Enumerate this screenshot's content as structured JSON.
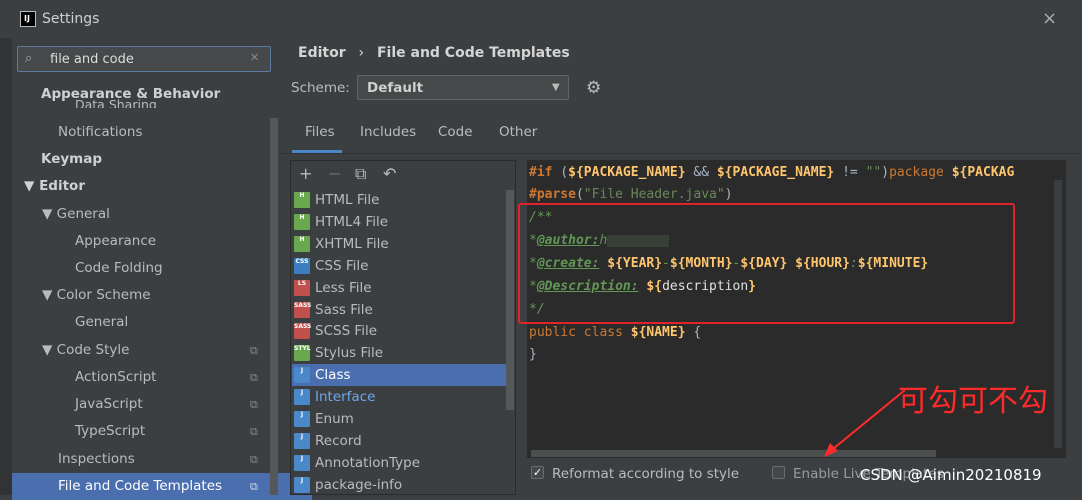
{
  "window": {
    "title": "Settings",
    "close_icon": "×"
  },
  "search": {
    "value": "file and code"
  },
  "sidebar": {
    "items": [
      {
        "label": "Appearance & Behavior",
        "sub": "Data Sharing"
      },
      {
        "label": "Notifications"
      },
      {
        "label": "Keymap"
      },
      {
        "label": "▼ Editor"
      },
      {
        "label": "▼ General"
      },
      {
        "label": "Appearance"
      },
      {
        "label": "Code Folding"
      },
      {
        "label": "▼ Color Scheme"
      },
      {
        "label": "General"
      },
      {
        "label": "▼ Code Style"
      },
      {
        "label": "ActionScript"
      },
      {
        "label": "JavaScript"
      },
      {
        "label": "TypeScript"
      },
      {
        "label": "Inspections"
      },
      {
        "label": "File and Code Templates"
      }
    ]
  },
  "breadcrumb": {
    "part1": "Editor",
    "sep": "›",
    "part2": "File and Code Templates"
  },
  "scheme": {
    "label": "Scheme:",
    "value": "Default"
  },
  "tabs": [
    "Files",
    "Includes",
    "Code",
    "Other"
  ],
  "list": {
    "items": [
      {
        "label": "HTML File",
        "badge": "H",
        "color": "#6aa84f"
      },
      {
        "label": "HTML4 File",
        "badge": "H",
        "color": "#6aa84f"
      },
      {
        "label": "XHTML File",
        "badge": "H",
        "color": "#6aa84f"
      },
      {
        "label": "CSS File",
        "badge": "CSS",
        "color": "#3c7fc1"
      },
      {
        "label": "Less File",
        "badge": "LS",
        "color": "#c0504d"
      },
      {
        "label": "Sass File",
        "badge": "SASS",
        "color": "#c0504d"
      },
      {
        "label": "SCSS File",
        "badge": "SASS",
        "color": "#c0504d"
      },
      {
        "label": "Stylus File",
        "badge": "STYL",
        "color": "#6aa84f"
      },
      {
        "label": "Class",
        "badge": "J",
        "color": "#4a88c7"
      },
      {
        "label": "Interface",
        "badge": "J",
        "color": "#4a88c7"
      },
      {
        "label": "Enum",
        "badge": "J",
        "color": "#4a88c7"
      },
      {
        "label": "Record",
        "badge": "J",
        "color": "#4a88c7"
      },
      {
        "label": "AnnotationType",
        "badge": "J",
        "color": "#4a88c7"
      },
      {
        "label": "package-info",
        "badge": "J",
        "color": "#4a88c7"
      }
    ]
  },
  "code": {
    "l1a": "#if",
    "l1b": " (",
    "l1c": "${PACKAGE_NAME}",
    "l1d": " && ",
    "l1e": "${PACKAGE_NAME}",
    "l1f": " != ",
    "l1g": "\"\"",
    "l1h": ")",
    "l1i": "package ",
    "l1j": "${PACKAG",
    "l2a": "#parse",
    "l2b": "(",
    "l2c": "\"File Header.java\"",
    "l2d": ")",
    "l3": "/**",
    "l4a": "*",
    "l4b": "@author:",
    "l4c": "h",
    "l5a": "*",
    "l5b": "@create:",
    "l5c": " ${YEAR}",
    "l5d": "-",
    "l5e": "${MONTH}",
    "l5f": "-",
    "l5g": "${DAY}",
    "l5h": " ${HOUR}",
    "l5i": ":",
    "l5j": "${MINUTE}",
    "l6a": "*",
    "l6b": "@Description:",
    "l6c": " ${",
    "l6d": "description",
    "l6e": "}",
    "l7": "*/",
    "l8a": "public class ",
    "l8b": "${NAME}",
    "l8c": " {",
    "l9": "}"
  },
  "annotation": "可勾可不勾",
  "bottom": {
    "reformat_label": "Reformat according to style",
    "live_label": "Enable Live Templates",
    "watermark": "CSDN @Aimin20210819"
  },
  "colors": {
    "accent": "#4b6eaf",
    "annotation": "#ff2a2a"
  }
}
